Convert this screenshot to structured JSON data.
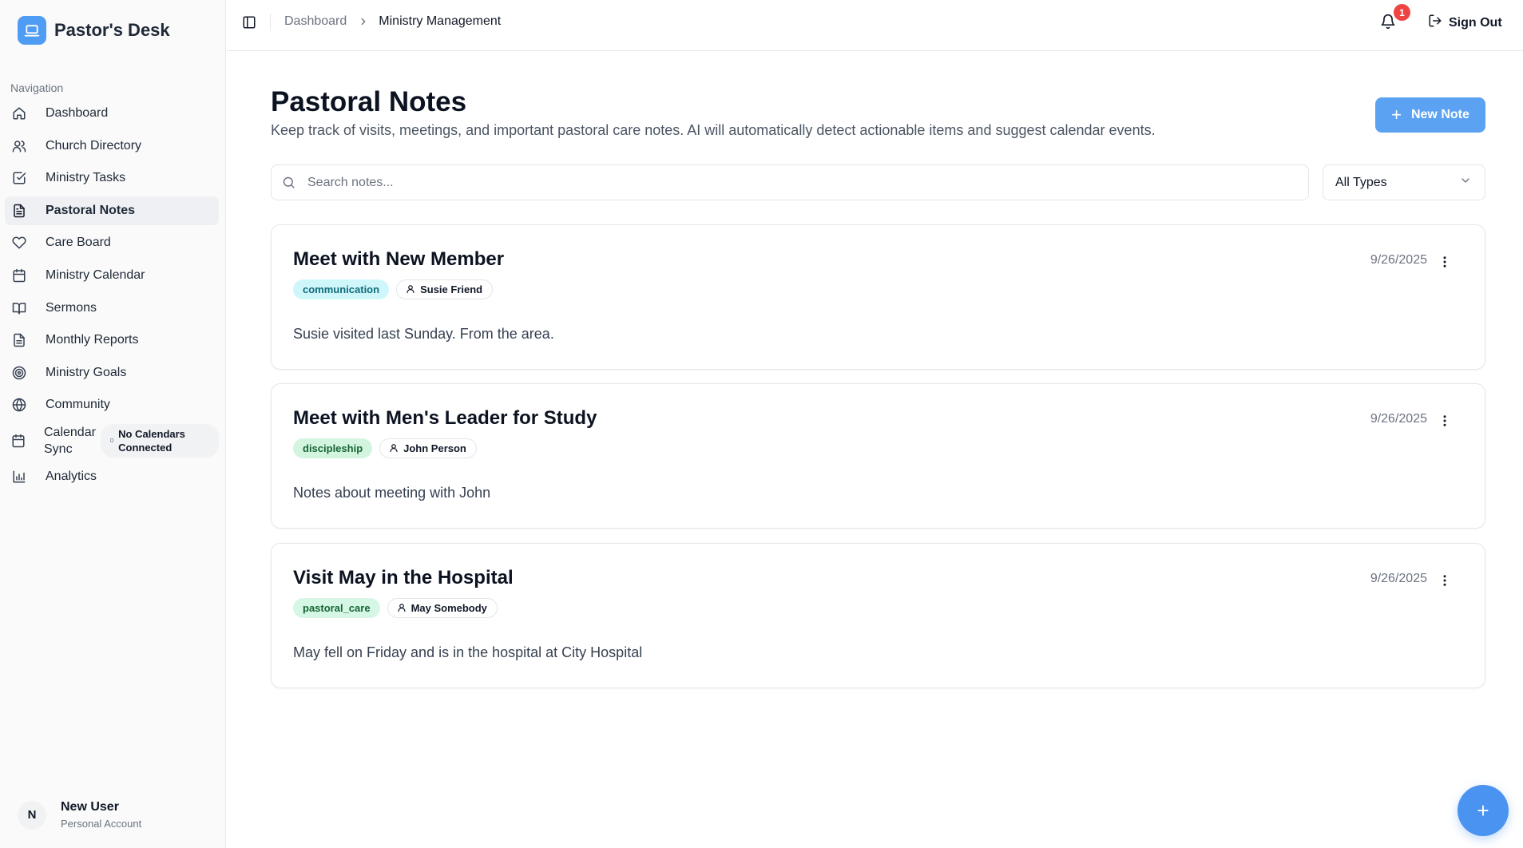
{
  "app": {
    "name": "Pastor's Desk"
  },
  "sidebar": {
    "heading": "Navigation",
    "items": [
      {
        "label": "Dashboard",
        "icon": "home-icon"
      },
      {
        "label": "Church Directory",
        "icon": "users-icon"
      },
      {
        "label": "Ministry Tasks",
        "icon": "checkbox-icon"
      },
      {
        "label": "Pastoral Notes",
        "icon": "file-text-icon",
        "active": true
      },
      {
        "label": "Care Board",
        "icon": "heart-icon"
      },
      {
        "label": "Ministry Calendar",
        "icon": "calendar-icon"
      },
      {
        "label": "Sermons",
        "icon": "book-open-icon"
      },
      {
        "label": "Monthly Reports",
        "icon": "file-icon"
      },
      {
        "label": "Ministry Goals",
        "icon": "target-icon"
      },
      {
        "label": "Community",
        "icon": "globe-icon"
      },
      {
        "label": "Calendar Sync",
        "icon": "calendar-icon",
        "badge": "No Calendars Connected"
      },
      {
        "label": "Analytics",
        "icon": "bar-chart-icon"
      }
    ],
    "user": {
      "initial": "N",
      "name": "New User",
      "account": "Personal Account"
    }
  },
  "header": {
    "breadcrumb": {
      "parent": "Dashboard",
      "current": "Ministry Management"
    },
    "notification_count": "1",
    "sign_out_label": "Sign Out"
  },
  "main": {
    "title": "Pastoral Notes",
    "subtitle": "Keep track of visits, meetings, and important pastoral care notes. AI will automatically detect actionable items and suggest calendar events.",
    "new_note_label": "New Note",
    "search": {
      "placeholder": "Search notes...",
      "value": ""
    },
    "type_filter": {
      "selected": "All Types"
    },
    "notes": [
      {
        "title": "Meet with New Member",
        "type": "communication",
        "person": "Susie Friend",
        "date": "9/26/2025",
        "body": "Susie visited last Sunday. From the area."
      },
      {
        "title": "Meet with Men's Leader for Study",
        "type": "discipleship",
        "person": "John Person",
        "date": "9/26/2025",
        "body": "Notes about meeting with John"
      },
      {
        "title": "Visit May in the Hospital",
        "type": "pastoral_care",
        "person": "May Somebody",
        "date": "9/26/2025",
        "body": "May fell on Friday and is in the hospital at City Hospital"
      }
    ]
  },
  "colors": {
    "accent": "#5ba3f2",
    "fab": "#4a93f0",
    "badge": "#ef4444",
    "tag_communication": "#cff7fb",
    "tag_discipleship": "#d3f5df",
    "tag_pastoral_care": "#d6f7e6"
  }
}
